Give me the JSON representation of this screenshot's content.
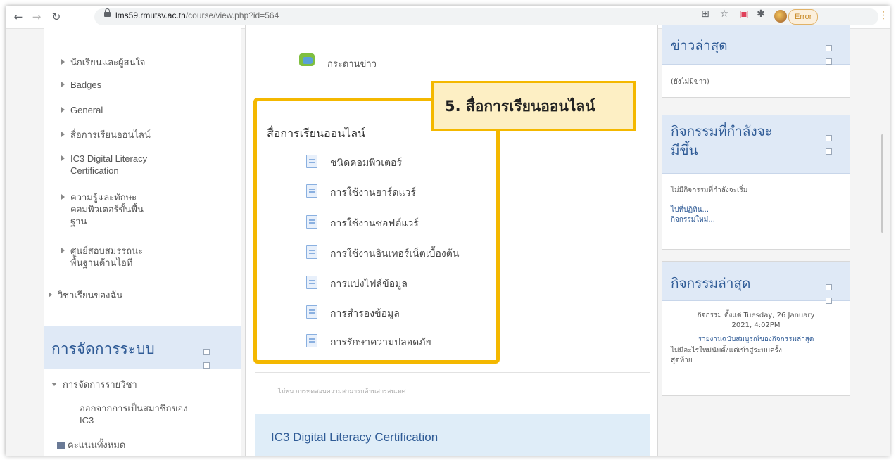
{
  "browser": {
    "url_host": "lms59.rmutsv.ac.th",
    "url_path": "/course/view.php?id=564",
    "error_label": "Error"
  },
  "left_nav": {
    "items": [
      "นักเรียนและผู้สนใจ",
      "Badges",
      "General",
      "สื่อการเรียนออนไลน์",
      "IC3 Digital Literacy",
      "Certification",
      "ความรู้และทักษะ",
      "คอมพิวเตอร์ขั้นพื้น",
      "ฐาน",
      "ศูนย์สอบสมรรถนะ",
      "พื้นฐานด้านไอที"
    ],
    "my_courses": "วิชาเรียนของฉัน"
  },
  "admin": {
    "title": "การจัดการระบบ",
    "course_admin": "การจัดการรายวิชา",
    "unenrol_line1": "ออกจากการเป็นสมาชิกของ",
    "unenrol_line2": "IC3",
    "grades": "คะแนนทั้งหมด"
  },
  "main": {
    "forum": "กระดานข่าว",
    "section_title": "สื่อการเรียนออนไลน์",
    "resources": [
      "ชนิดคอมพิวเตอร์",
      "การใช้งานฮาร์ดแวร์",
      "การใช้งานซอฟต์แวร์",
      "การใช้งานอินเทอร์เน็ตเบื้องต้น",
      "การแบ่งไฟล์ข้อมูล",
      "การสำรองข้อมูล",
      "การรักษาความปลอดภัย"
    ],
    "callout": "5. สื่อการเรียนออนไลน์",
    "not_found": "ไม่พบ การทดสอบความสามารถด้านสารสนเทศ",
    "ic3_title": "IC3 Digital Literacy Certification"
  },
  "news": {
    "title": "ข่าวล่าสุด",
    "empty": "(ยังไม่มีข่าว)"
  },
  "upcoming": {
    "title_line1": "กิจกรรมที่กำลังจะ",
    "title_line2": "มีขึ้น",
    "none": "ไม่มีกิจกรรมที่กำลังจะเริ่ม",
    "go_calendar": "ไปที่ปฏิทิน...",
    "new_event": "กิจกรรมใหม่..."
  },
  "recent": {
    "title": "กิจกรรมล่าสุด",
    "since_line1": "กิจกรรม ตั้งแต่ Tuesday, 26 January",
    "since_line2": "2021, 4:02PM",
    "full_report": "รายงานฉบับสมบูรณ์ของกิจกรรมล่าสุด",
    "nothing_line1": "ไม่มีอะไรใหม่นับตั้งแต่เข้าสู่ระบบครั้ง",
    "nothing_line2": "สุดท้าย"
  }
}
